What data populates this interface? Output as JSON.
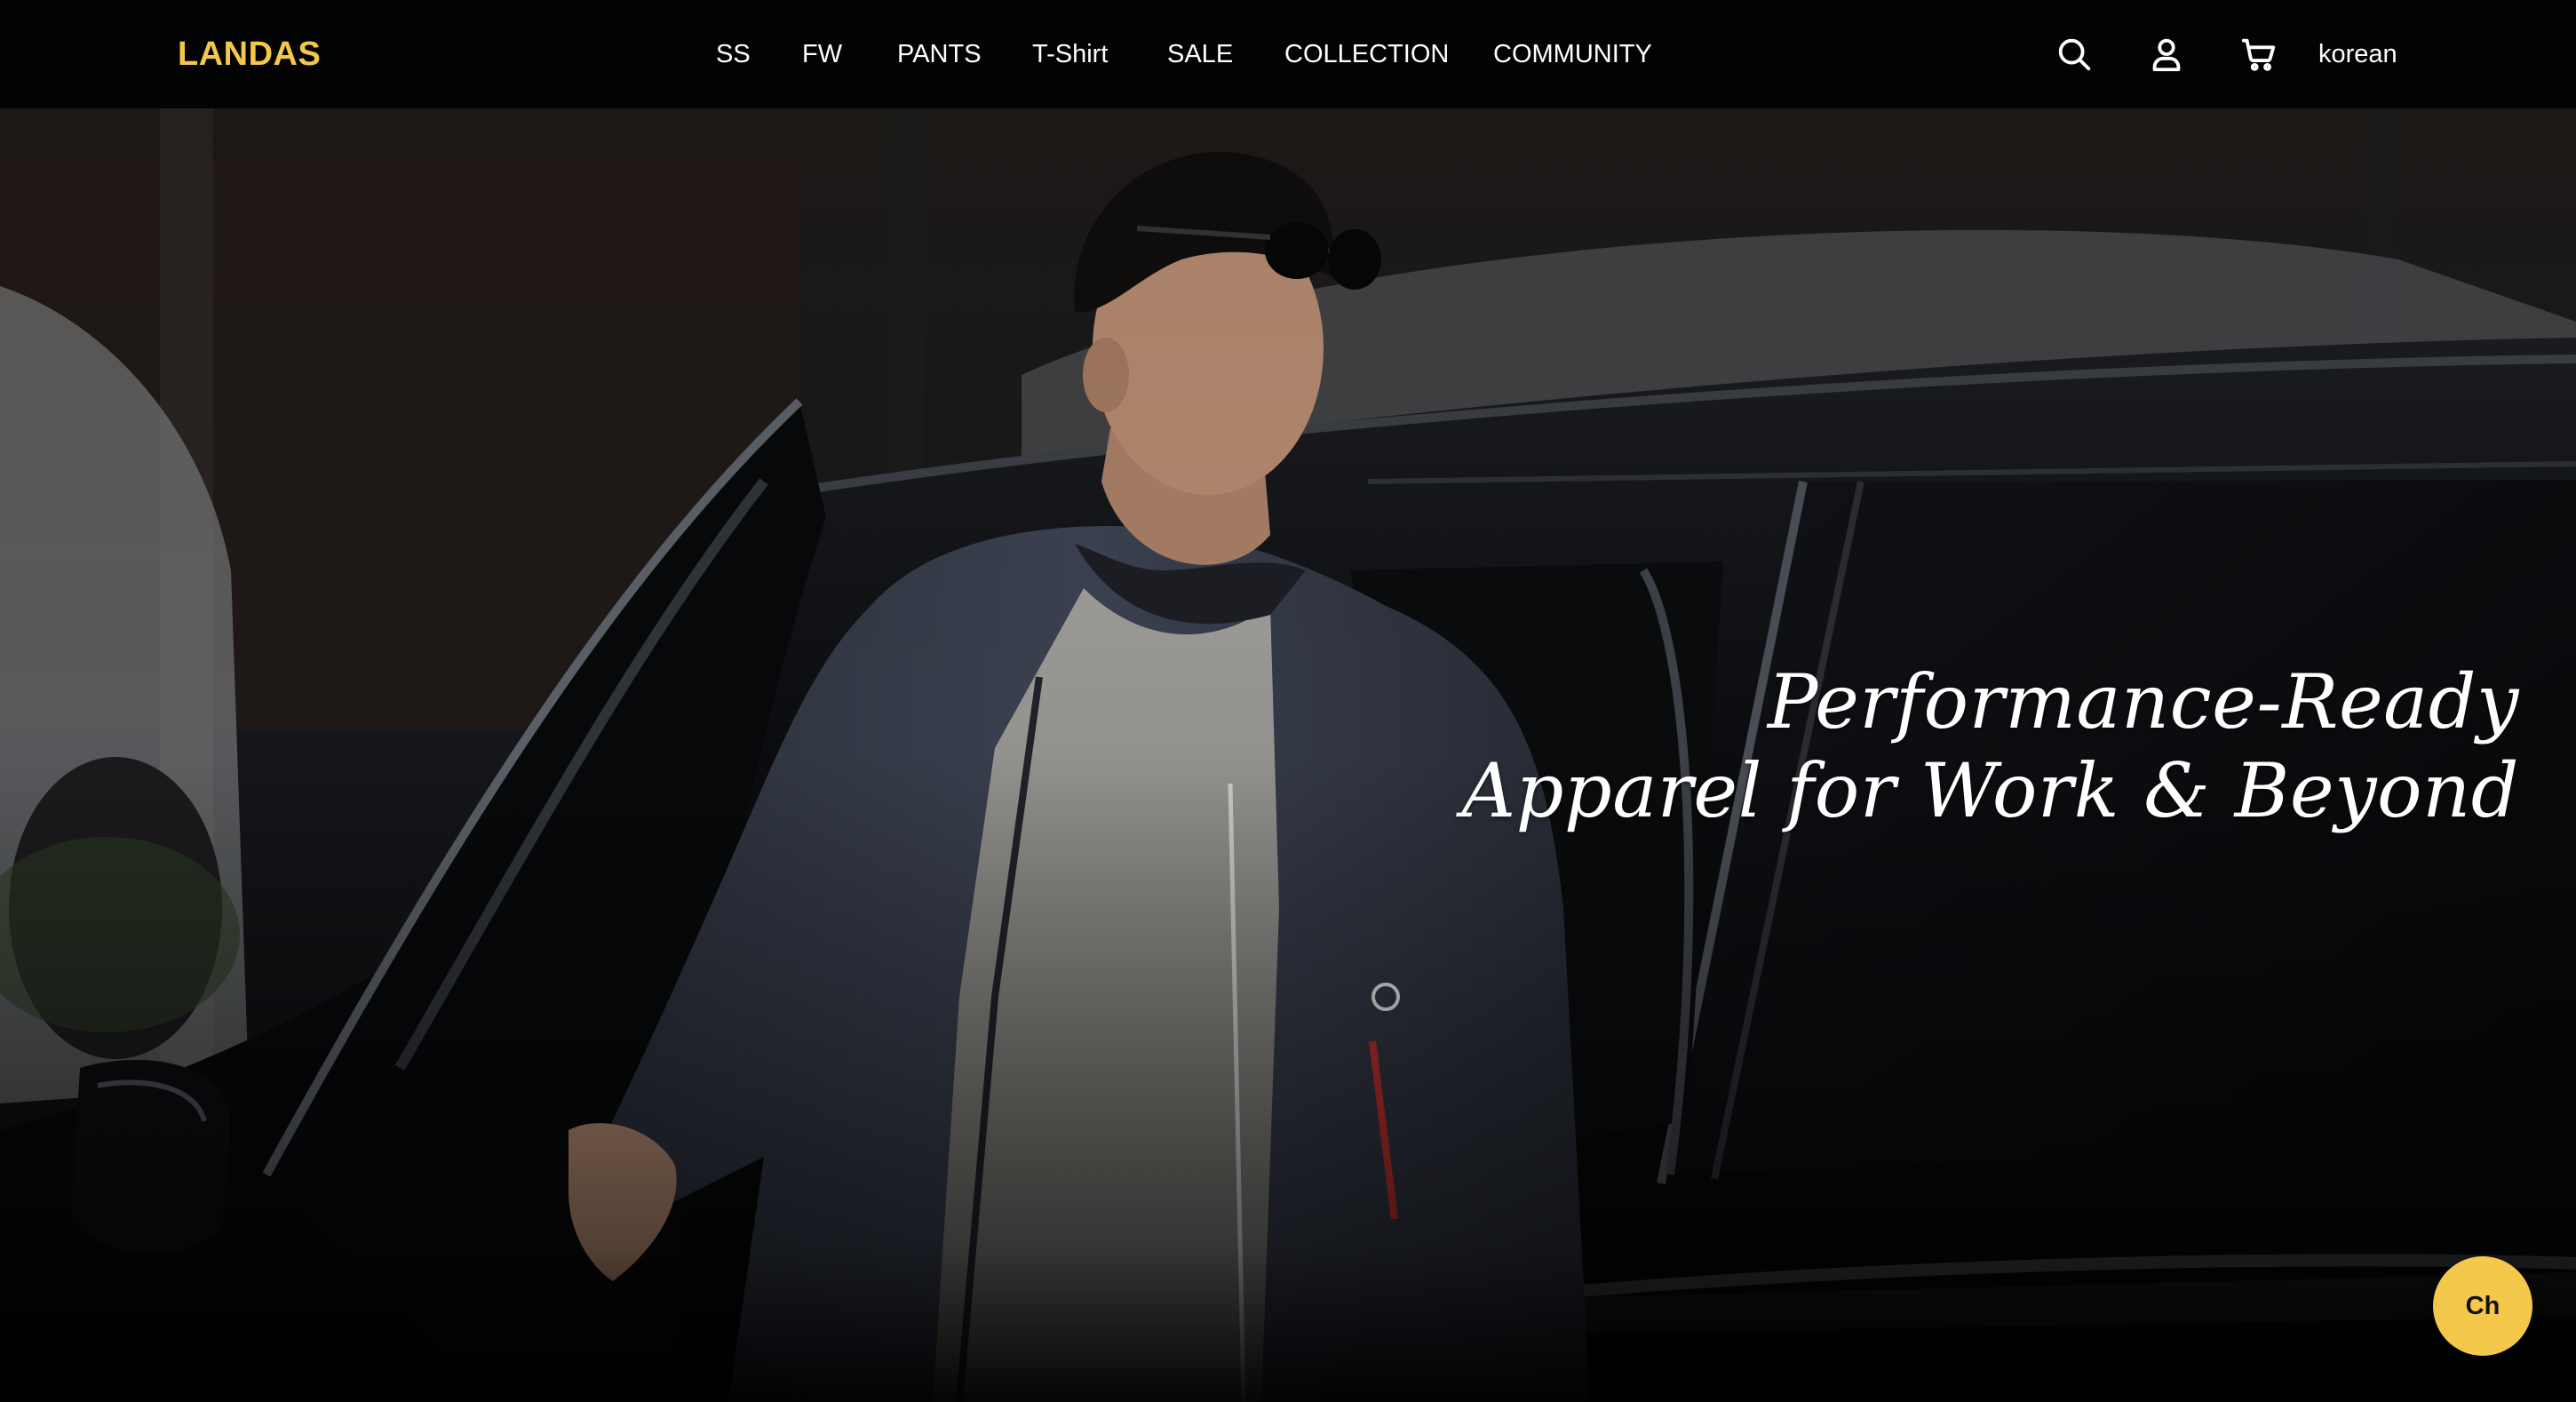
{
  "header": {
    "logo": "LANDAS",
    "nav": {
      "ss": "SS",
      "fw": "FW",
      "pants": "PANTS",
      "tshirt": "T-Shirt",
      "sale": "SALE",
      "collection": "COLLECTION",
      "community": "COMMUNITY"
    },
    "icons": {
      "search": "search-icon",
      "account": "user-icon",
      "cart": "cart-icon"
    },
    "language": "korean"
  },
  "hero": {
    "heading_line1": "Performance-Ready",
    "heading_line2": "Apparel for Work & Beyond"
  },
  "chat": {
    "label": "Ch"
  },
  "colors": {
    "accent": "#f3c84b",
    "header_bg": "#030303",
    "text": "#ffffff"
  }
}
